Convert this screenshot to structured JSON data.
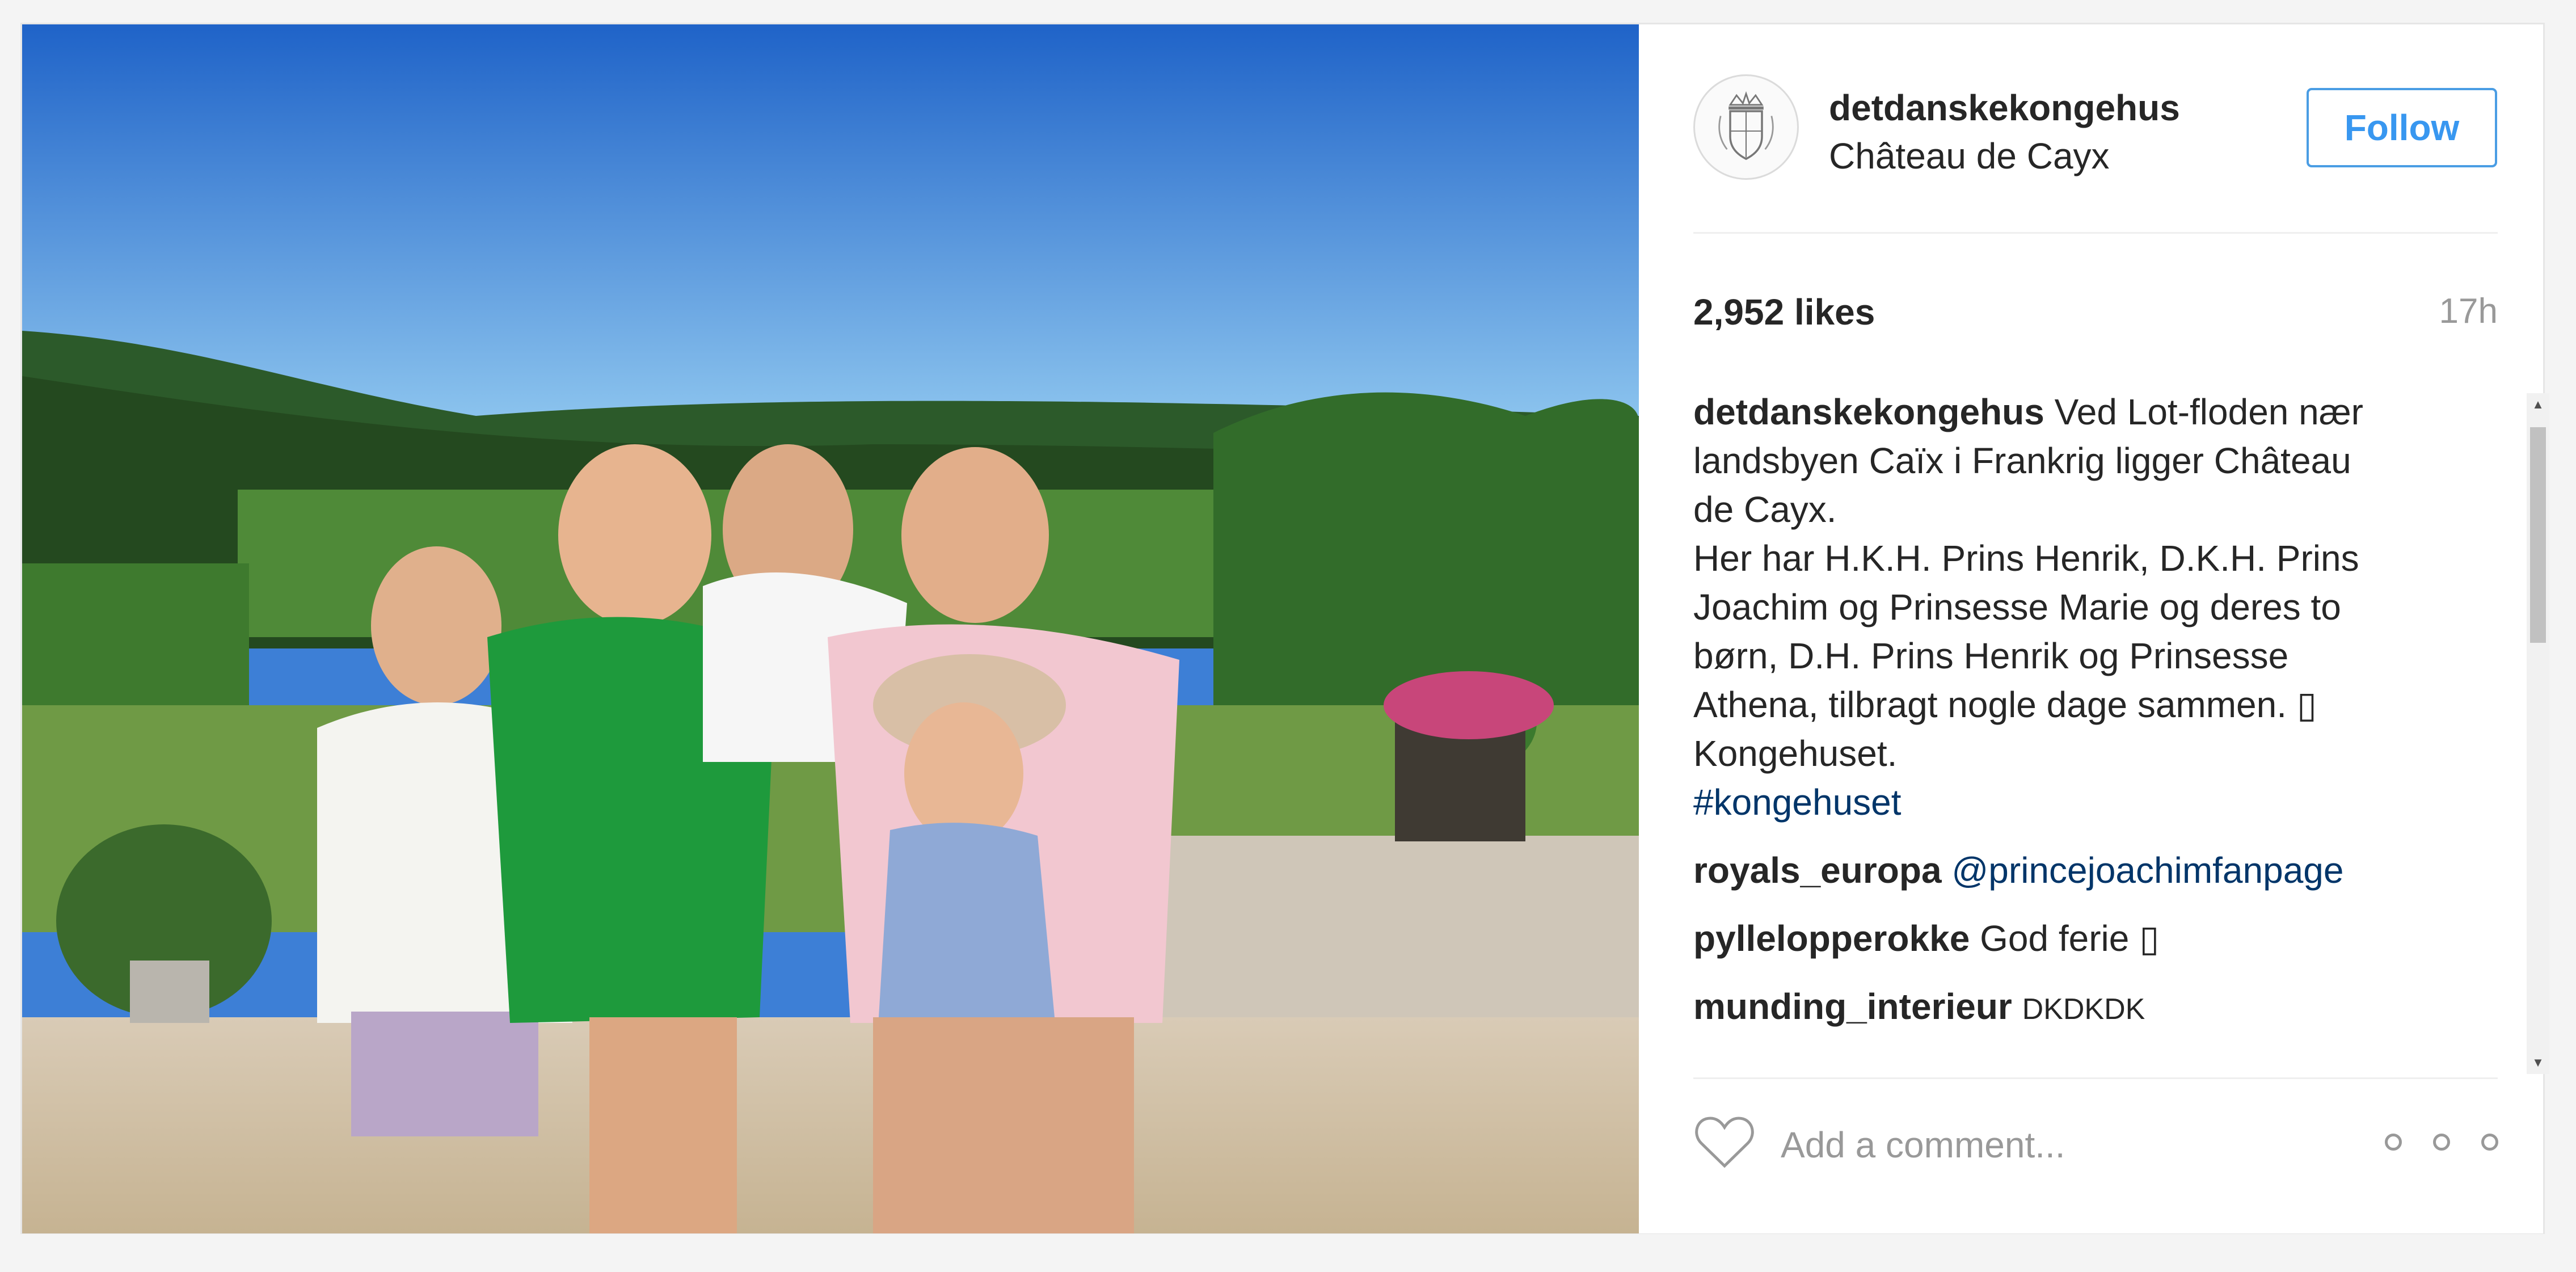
{
  "post": {
    "photo_alt": "",
    "author": {
      "username": "detdanskekongehus",
      "location": "Château de Cayx",
      "avatar_icon": "royal-crest-icon"
    },
    "follow_label": "Follow",
    "likes": "2,952 likes",
    "time_ago": "17h",
    "caption": {
      "username": "detdanskekongehus",
      "lines": [
        "Ved Lot-floden nær",
        "landsbyen Caïx i Frankrig ligger Château",
        "de Cayx.",
        "Her har H.K.H. Prins Henrik, D.K.H. Prins",
        "Joachim og Prinsesse Marie og deres to",
        "børn, D.H. Prins Henrik og Prinsesse",
        "Athena, tilbragt nogle dage sammen. ▯",
        "Kongehuset."
      ],
      "hashtag": "#kongehuset"
    },
    "comments": [
      {
        "username": "royals_europa",
        "text": "@princejoachimfanpage"
      },
      {
        "username": "pyllelopperokke",
        "text": "God ferie ▯"
      },
      {
        "username": "munding_interieur",
        "text": "DKDKDK"
      }
    ],
    "comment_placeholder": "Add a comment...",
    "scroll_up": "▲",
    "scroll_down": "▼"
  },
  "colors": {
    "link": "#003569",
    "follow": "#3897f0",
    "muted": "#999999"
  }
}
